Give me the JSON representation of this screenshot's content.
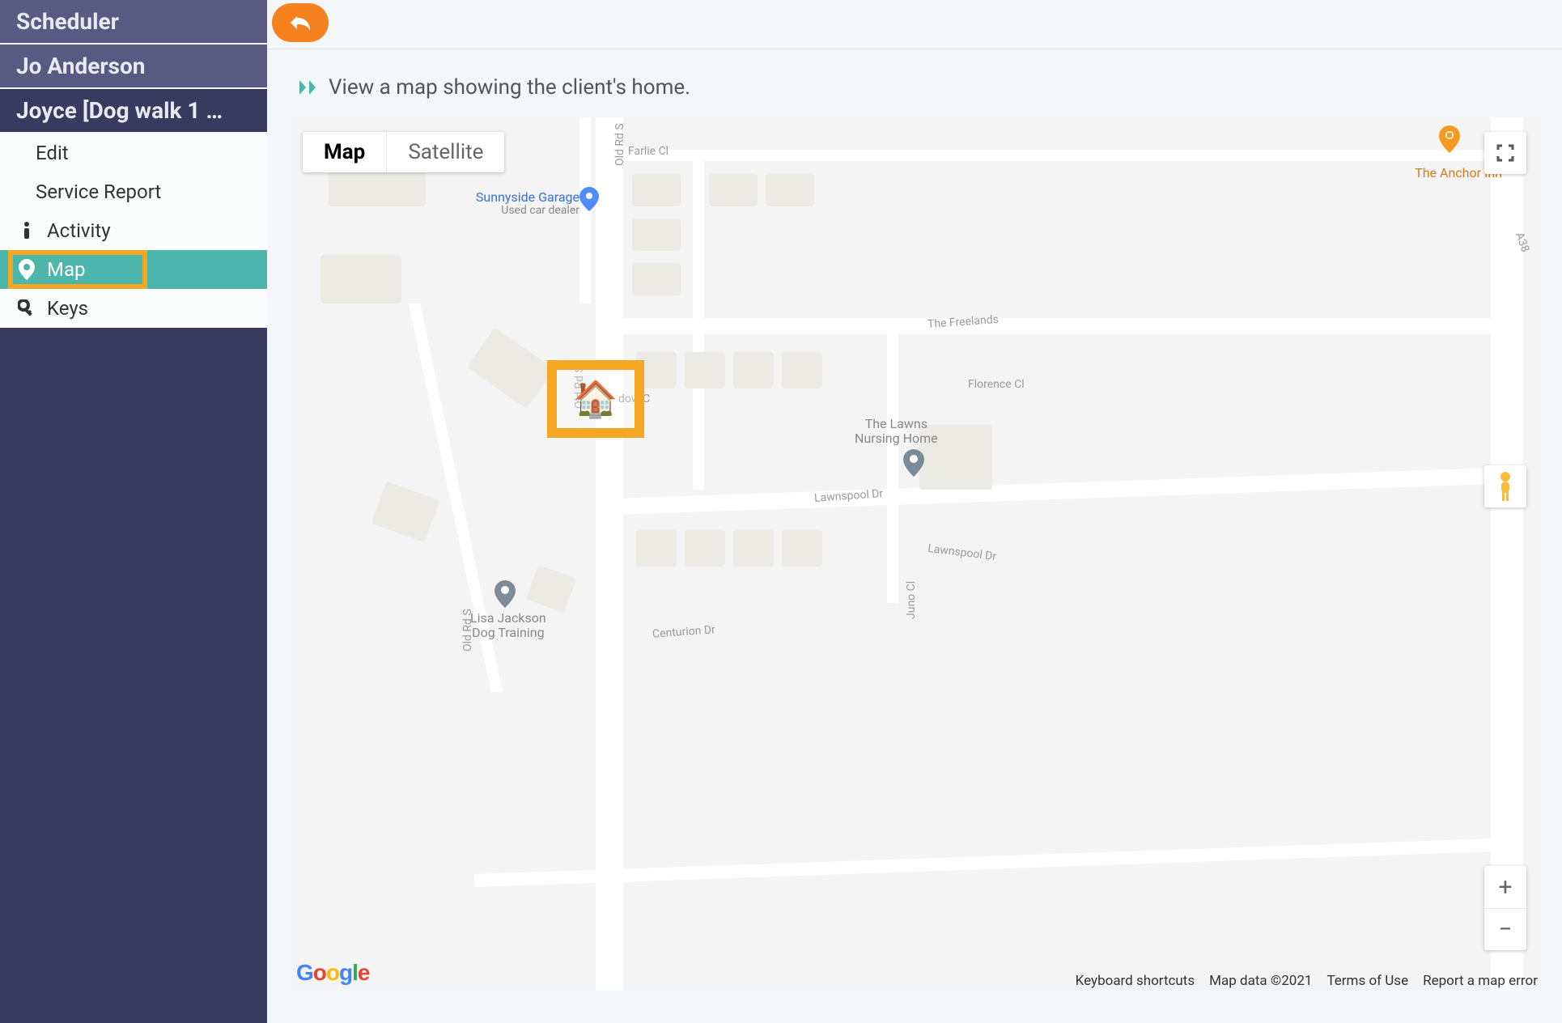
{
  "sidebar": {
    "crumbs": [
      "Scheduler",
      "Jo Anderson",
      "Joyce [Dog walk 1 …"
    ],
    "menu": [
      {
        "label": "Edit",
        "icon": null
      },
      {
        "label": "Service Report",
        "icon": null
      },
      {
        "label": "Activity",
        "icon": "info"
      },
      {
        "label": "Map",
        "icon": "pin",
        "active": true,
        "highlighted": true
      },
      {
        "label": "Keys",
        "icon": "key"
      }
    ]
  },
  "heading": "View a map showing the client's home.",
  "map": {
    "type_options": {
      "map": "Map",
      "satellite": "Satellite"
    },
    "selected_type": "map",
    "roads": {
      "old_rd_s": "Old Rd S",
      "farlie_cl": "Farlie Cl",
      "a38": "A38",
      "the_freelands": "The Freelands",
      "florence_cl": "Florence Cl",
      "lawnspool_dr": "Lawnspool Dr",
      "lawnspool_dr_2": "Lawnspool Dr",
      "centurion_dr": "Centurion Dr",
      "juno_cl": "Juno Cl",
      "dow_c": "dow C"
    },
    "pois": {
      "sunnyside": {
        "title": "Sunnyside Garage",
        "sub": "Used car dealer"
      },
      "anchor": "The Anchor Inn",
      "lawns": "The Lawns\nNursing Home",
      "lisa": "Lisa Jackson\nDog Training"
    },
    "footer": {
      "shortcuts": "Keyboard shortcuts",
      "data": "Map data ©2021",
      "terms": "Terms of Use",
      "report": "Report a map error"
    }
  }
}
